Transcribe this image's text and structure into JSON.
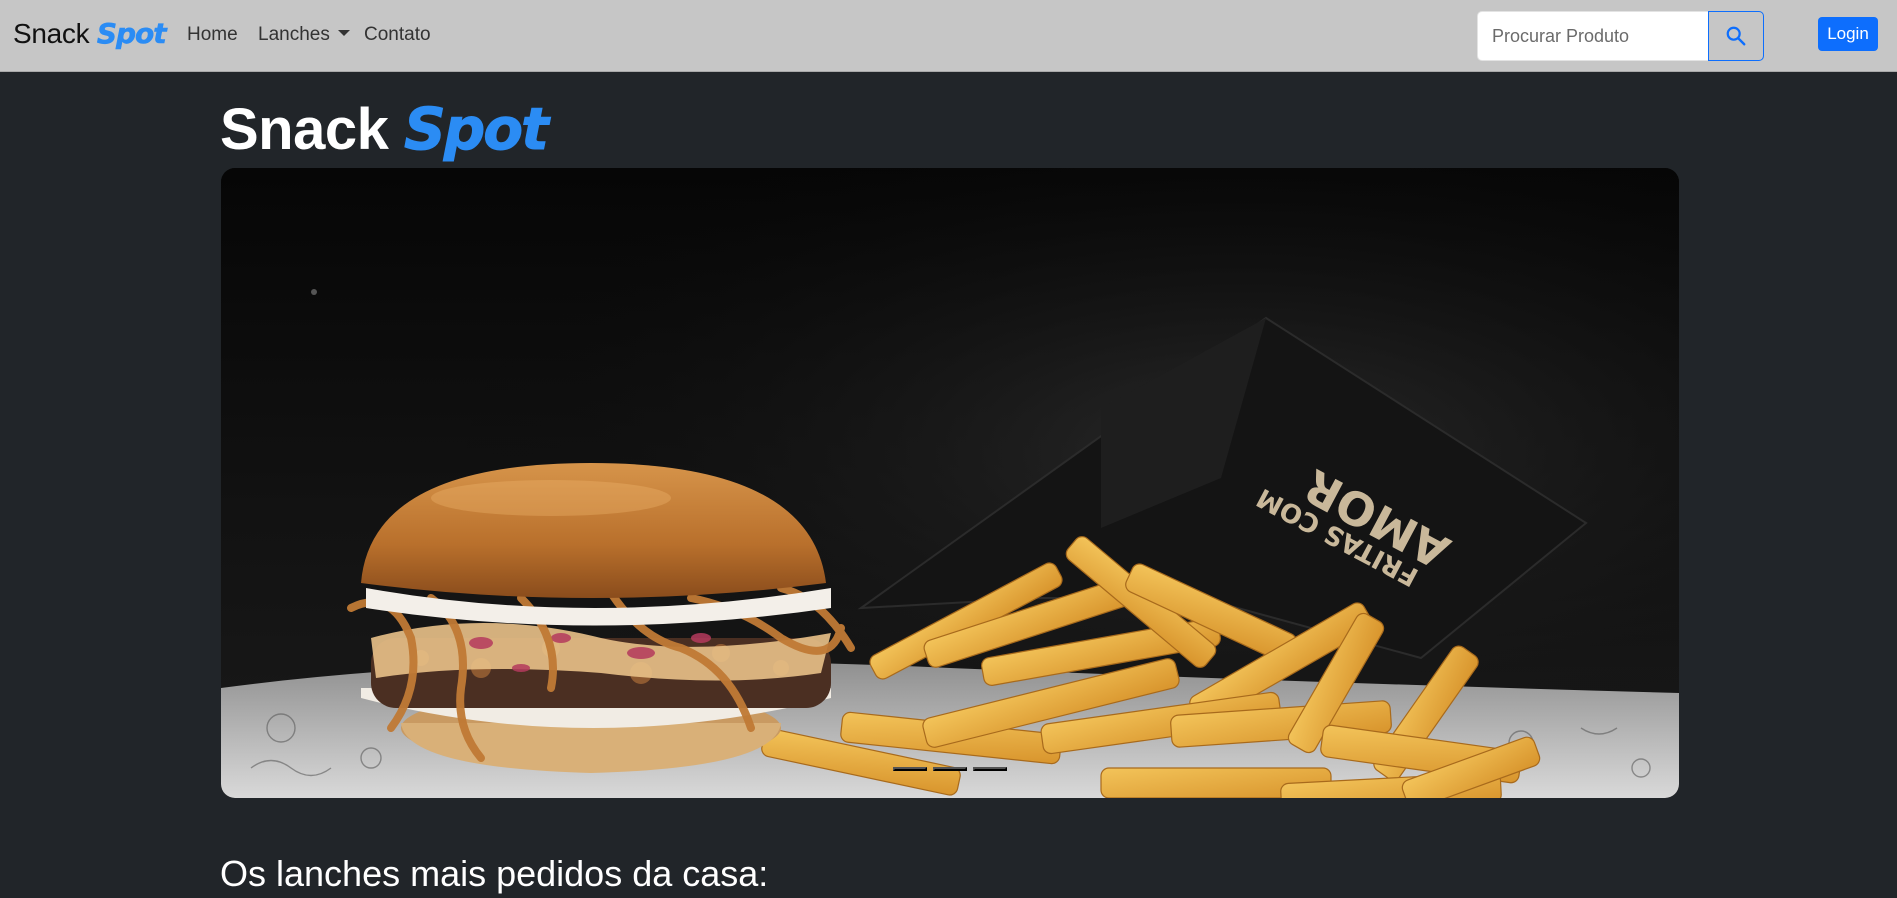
{
  "navbar": {
    "brand_word1": "Snack",
    "brand_word2": "Spot",
    "links": [
      "Home",
      "Lanches",
      "Contato"
    ],
    "search_placeholder": "Procurar Produto",
    "login_label": "Login"
  },
  "hero": {
    "title_word1": "Snack",
    "title_word2": "Spot",
    "carousel": {
      "slide_count": 3,
      "active_index": 0,
      "box_text_line1": "FRITAS COM",
      "box_text_line2": "AMOR"
    }
  },
  "section": {
    "heading": "Os lanches mais pedidos da casa:"
  },
  "colors": {
    "navbar_bg": "#c6c6c6",
    "page_bg": "#212529",
    "brand_accent": "#2b8cf4",
    "primary": "#0d6efd"
  },
  "icons": [
    "search-icon",
    "chevron-down-icon"
  ]
}
